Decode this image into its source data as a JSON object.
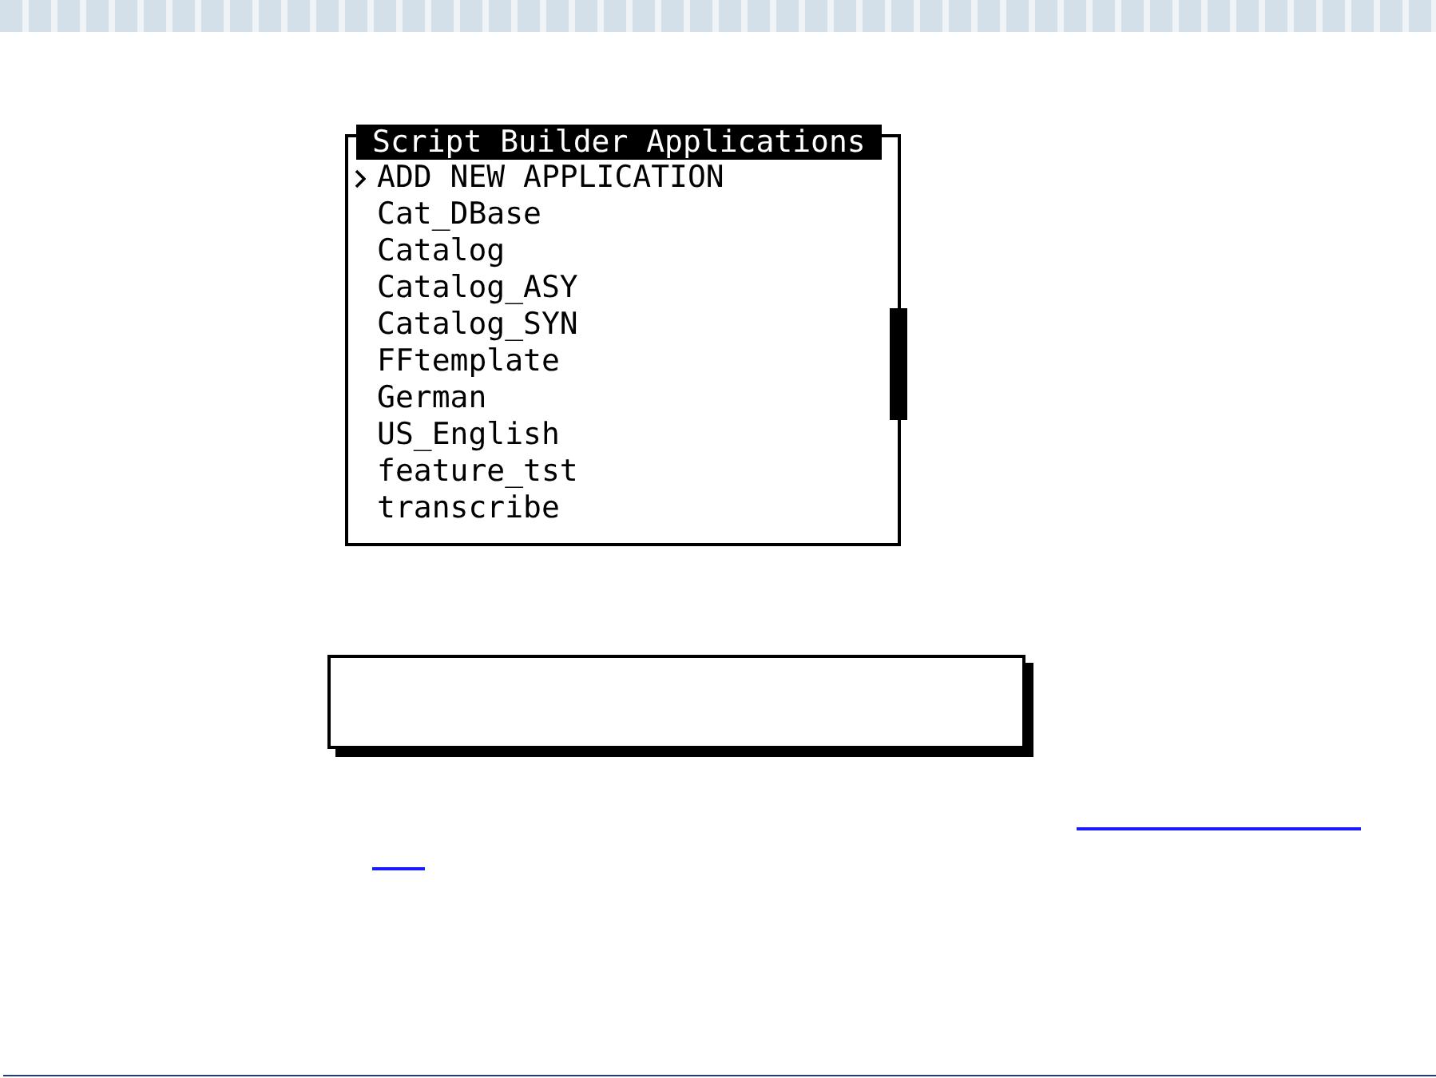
{
  "menu": {
    "title": "Script Builder Applications",
    "items": [
      {
        "label": "ADD NEW APPLICATION",
        "selected": true
      },
      {
        "label": "Cat_DBase",
        "selected": false
      },
      {
        "label": "Catalog",
        "selected": false
      },
      {
        "label": "Catalog_ASY",
        "selected": false
      },
      {
        "label": "Catalog_SYN",
        "selected": false
      },
      {
        "label": "FFtemplate",
        "selected": false
      },
      {
        "label": "German",
        "selected": false
      },
      {
        "label": "US_English",
        "selected": false
      },
      {
        "label": "feature_tst",
        "selected": false
      },
      {
        "label": "transcribe",
        "selected": false
      }
    ]
  }
}
